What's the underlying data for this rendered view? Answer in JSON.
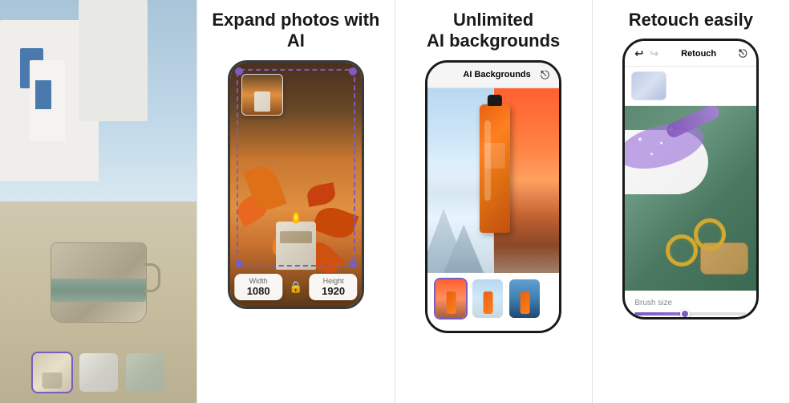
{
  "panels": [
    {
      "id": "panel1",
      "title": "",
      "thumbnails": [
        {
          "label": "thumb-selected",
          "type": "ceramic-cup-selected"
        },
        {
          "label": "thumb-2",
          "type": "stones-light"
        },
        {
          "label": "thumb-3",
          "type": "stones-dark"
        }
      ]
    },
    {
      "id": "panel2",
      "title": "Expand\nphotos with AI",
      "dimensions": {
        "width_label": "Width",
        "width_value": "1080",
        "height_label": "Height",
        "height_value": "1920"
      }
    },
    {
      "id": "panel3",
      "title": "Unlimited\nAI backgrounds",
      "header_label": "AI Backgrounds"
    },
    {
      "id": "panel4",
      "title": "Retouch\neasily",
      "header_label": "Retouch",
      "brush_label": "Brush size"
    }
  ]
}
